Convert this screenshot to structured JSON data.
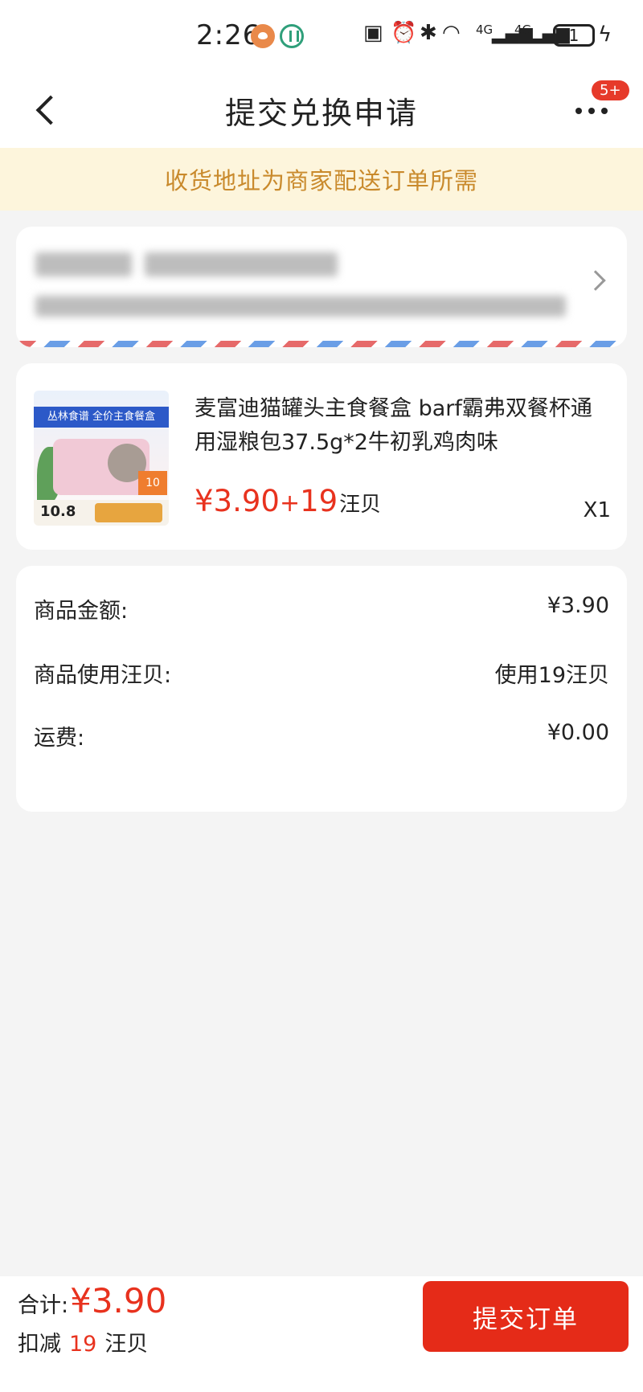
{
  "status_bar": {
    "time": "2:26",
    "battery": "1",
    "icons": [
      "app-orange-icon",
      "app-green-icon",
      "nfc-icon",
      "alarm-icon",
      "bluetooth-icon",
      "wifi-icon",
      "signal-4g-icon",
      "signal-4g-icon",
      "battery-icon",
      "charging-icon"
    ],
    "signal_label_1": "4G",
    "signal_label_2": "4G"
  },
  "header": {
    "title": "提交兑换申请",
    "badge": "5+"
  },
  "notice": {
    "text": "收货地址为商家配送订单所需"
  },
  "product": {
    "title": "麦富迪猫罐头主食餐盒 barf霸弗双餐杯通用湿粮包37.5g*2牛初乳鸡肉味",
    "price": "¥3.90",
    "plus": "+",
    "points": "19",
    "points_unit": "汪贝",
    "quantity": "X1",
    "thumb": {
      "banner": "丛林食谱 全价主食餐盒",
      "badge": "10",
      "price": "10.8"
    }
  },
  "summary": {
    "rows": [
      {
        "label": "商品金额:",
        "value": "¥3.90"
      },
      {
        "label": "商品使用汪贝:",
        "value": "使用19汪贝"
      },
      {
        "label": "运费:",
        "value": "¥0.00"
      }
    ]
  },
  "footer": {
    "total_label": "合计:",
    "total_value": "¥3.90",
    "deduct_label": "扣减",
    "deduct_num": "19",
    "deduct_unit": "汪贝",
    "submit_label": "提交订单"
  },
  "colors": {
    "accent": "#e8321e",
    "notice_bg": "#fdf5dc",
    "notice_text": "#c98a2c",
    "page_bg": "#f4f4f4"
  }
}
